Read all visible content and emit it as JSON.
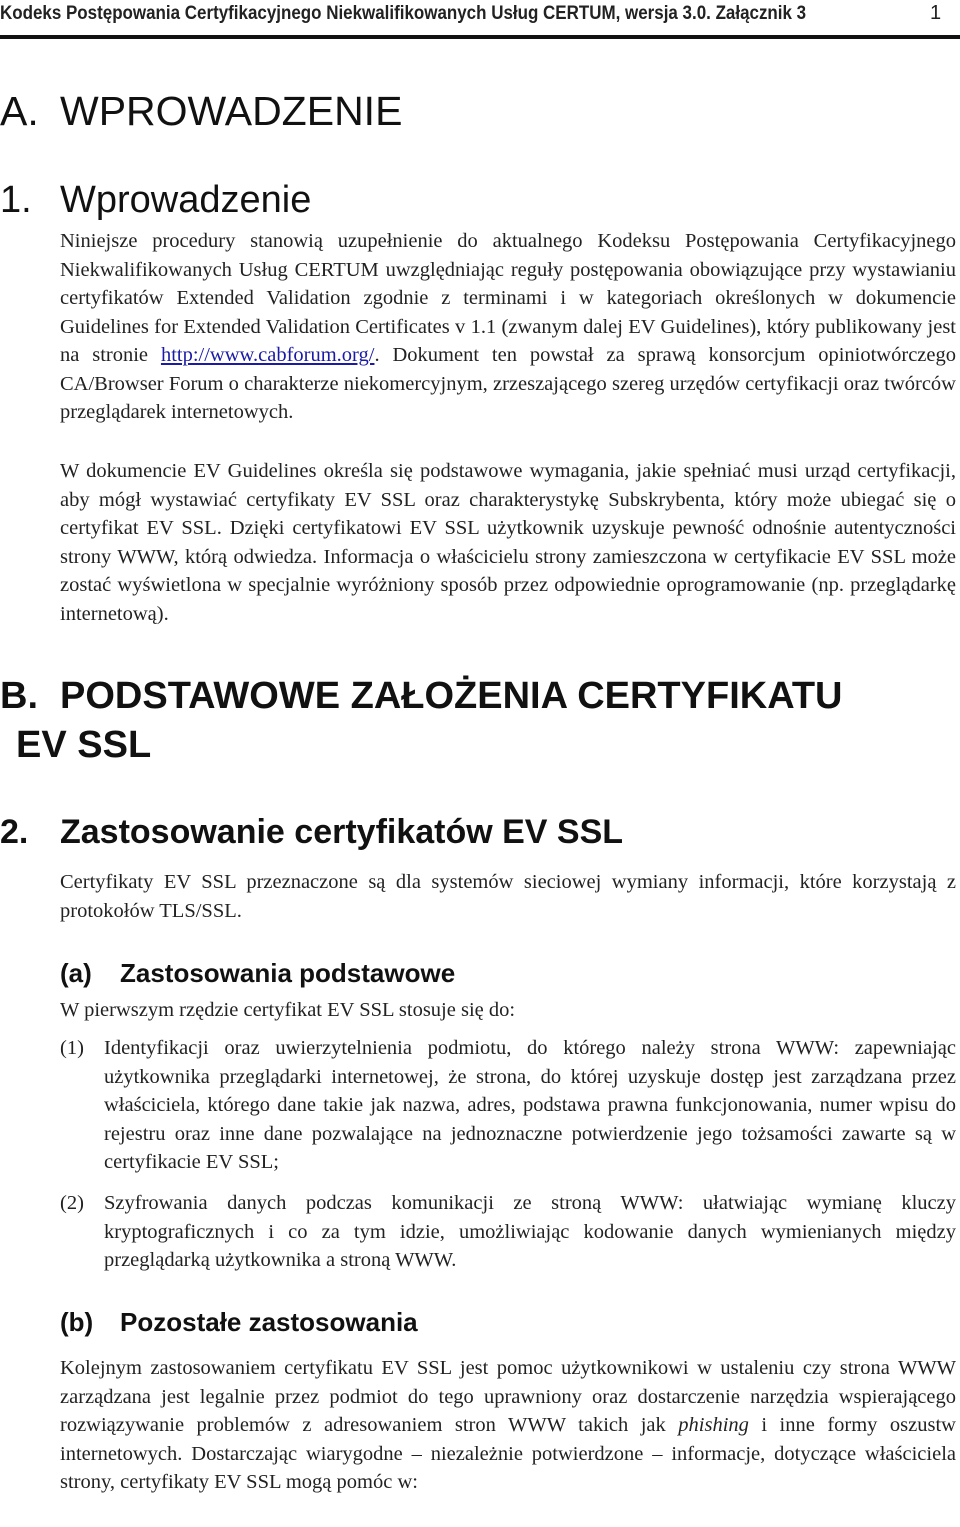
{
  "header": {
    "title": "Kodeks Postępowania Certyfikacyjnego Niekwalifikowanych Usług CERTUM, wersja 3.0. Załącznik 3",
    "page_number": "1"
  },
  "section_a": {
    "label": "A.",
    "title": "WPROWADZENIE"
  },
  "section_1": {
    "number": "1.",
    "title": "Wprowadzenie",
    "paragraph1_before_link": "Niniejsze procedury stanowią uzupełnienie do aktualnego Kodeksu Postępowania Certyfikacyjnego Niekwalifikowanych Usług CERTUM uwzględniając reguły postępowania obowiązujące przy wystawianiu certyfikatów Extended Validation zgodnie z terminami i w kategoriach określonych w dokumencie Guidelines for Extended Validation Certificates v 1.1 (zwanym dalej EV Guidelines), który publikowany jest na stronie ",
    "link": "http://www.cabforum.org/",
    "paragraph1_after_link": ". Dokument ten powstał za sprawą konsorcjum opiniotwórczego CA/Browser Forum o charakterze niekomercyjnym, zrzeszającego szereg urzędów certyfikacji oraz twórców przeglądarek internetowych.",
    "paragraph2": "W dokumencie EV Guidelines  określa się podstawowe wymagania, jakie spełniać musi urząd certyfikacji, aby mógł wystawiać certyfikaty EV SSL oraz charakterystykę Subskrybenta, który może ubiegać się o certyfikat EV SSL. Dzięki certyfikatowi EV SSL użytkownik uzyskuje pewność odnośnie autentyczności strony WWW, którą odwiedza. Informacja o właścicielu strony zamieszczona w certyfikacie EV SSL może zostać wyświetlona w specjalnie wyróżniony sposób przez odpowiednie oprogramowanie (np. przeglądarkę internetową)."
  },
  "section_b": {
    "label": "B.",
    "title_line1": "PODSTAWOWE ZAŁOŻENIA CERTYFIKATU",
    "title_line2": "EV SSL"
  },
  "section_2": {
    "number": "2.",
    "title": "Zastosowanie certyfikatów EV SSL",
    "paragraph": "Certyfikaty EV SSL przeznaczone są dla systemów sieciowej wymiany informacji, które korzystają z protokołów TLS/SSL.",
    "subsection_a": {
      "label": "(a)",
      "title": "Zastosowania podstawowe",
      "intro": "W pierwszym rzędzie certyfikat EV SSL stosuje się do:",
      "items": [
        {
          "marker": "(1)",
          "text": "Identyfikacji oraz uwierzytelnienia podmiotu, do którego należy strona WWW: zapewniając użytkownika przeglądarki internetowej, że strona, do której uzyskuje dostęp jest zarządzana przez właściciela, którego dane takie jak nazwa, adres, podstawa prawna funkcjonowania, numer wpisu do rejestru oraz inne dane pozwalające na jednoznaczne potwierdzenie jego tożsamości zawarte są w certyfikacie EV SSL;"
        },
        {
          "marker": "(2)",
          "text": "Szyfrowania danych podczas komunikacji ze stroną WWW: ułatwiając wymianę kluczy kryptograficznych i co za tym idzie, umożliwiając kodowanie danych wymienianych między przeglądarką użytkownika a stroną WWW."
        }
      ]
    },
    "subsection_b": {
      "label": "(b)",
      "title": "Pozostałe zastosowania",
      "text_before_italic": "Kolejnym zastosowaniem certyfikatu EV SSL jest pomoc użytkownikowi w ustaleniu czy strona WWW zarządzana jest legalnie przez podmiot do tego uprawniony oraz dostarczenie narzędzia wspierającego rozwiązywanie problemów z adresowaniem stron WWW takich jak ",
      "italic": "phishing",
      "text_after_italic": " i inne formy oszustw internetowych. Dostarczając wiarygodne – niezależnie potwierdzone – informacje, dotyczące właściciela strony, certyfikaty EV SSL mogą pomóc w:"
    }
  }
}
